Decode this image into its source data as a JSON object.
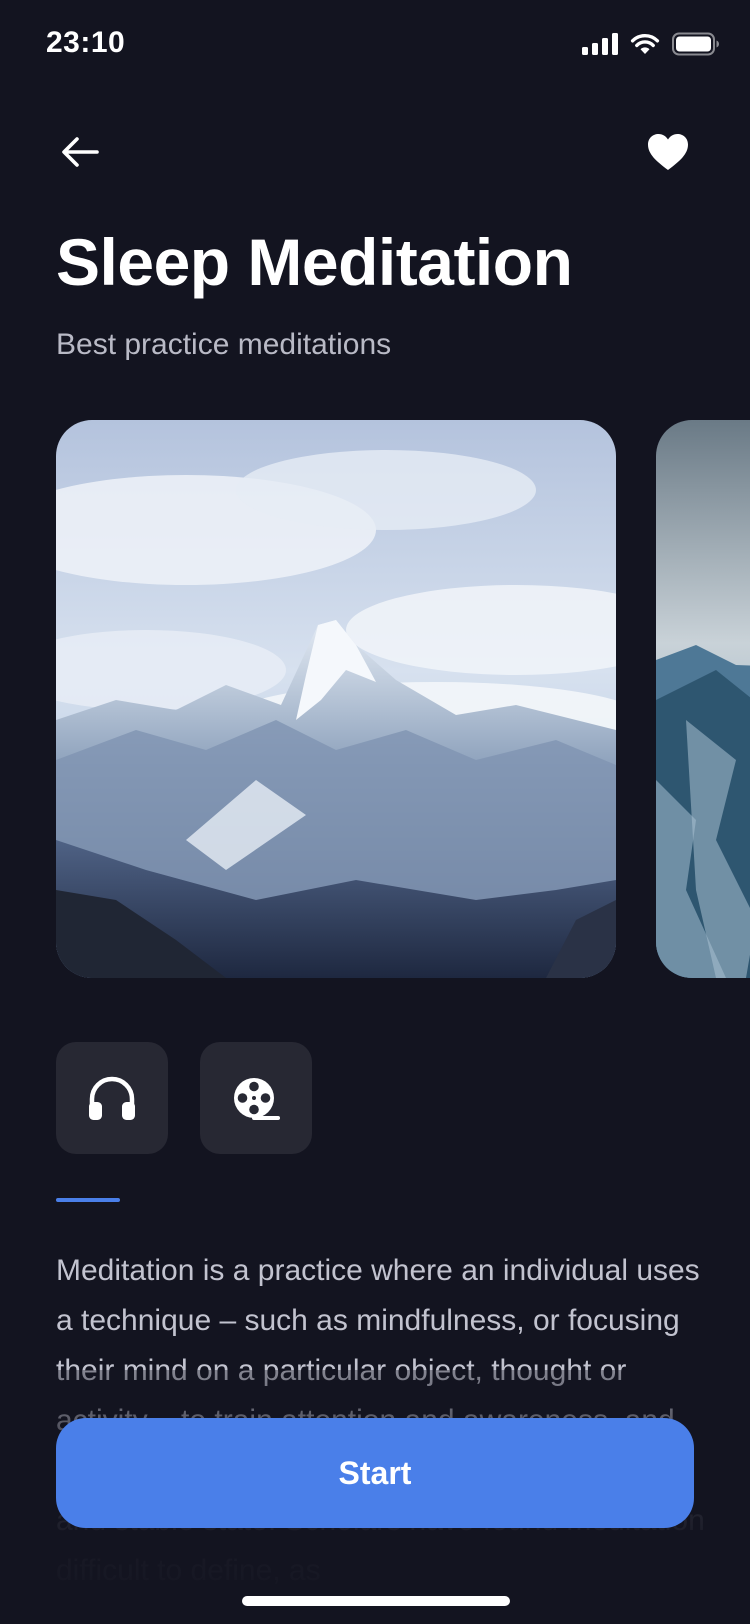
{
  "status_bar": {
    "time": "23:10",
    "icons": [
      "signal-icon",
      "wifi-icon",
      "battery-icon"
    ]
  },
  "header": {
    "back_icon": "arrow-left-icon",
    "favorite_icon": "heart-icon"
  },
  "page": {
    "title": "Sleep Meditation",
    "subtitle": "Best practice meditations"
  },
  "carousel": {
    "cards": [
      {
        "image": "snowy-mountain-peak"
      },
      {
        "image": "mountain-landscape"
      }
    ]
  },
  "media_types": [
    {
      "icon": "headphones-icon",
      "active": true
    },
    {
      "icon": "film-reel-icon",
      "active": false
    }
  ],
  "description": "Meditation is a practice where an individual uses a technique – such as mindfulness, or focusing their mind on a particular object, thought or activity – to train attention and awareness, and achieve a mentally clear and emotionally calm and stable state. Scholars have found meditation difficult to define, as",
  "actions": {
    "start_label": "Start"
  },
  "colors": {
    "background": "#131420",
    "accent": "#4a7fe9",
    "tile": "#272833",
    "subtitle": "#b9bac6"
  }
}
